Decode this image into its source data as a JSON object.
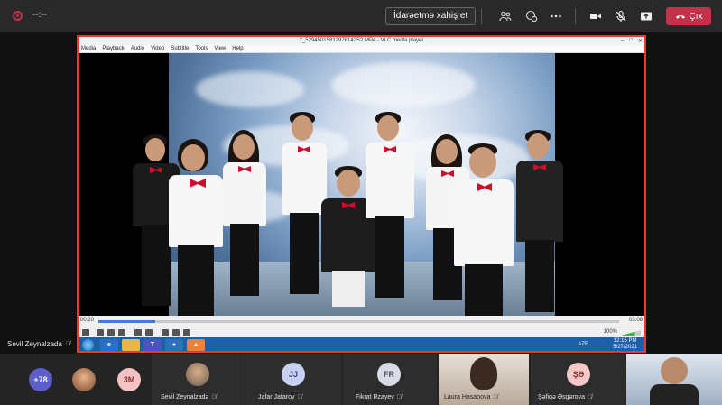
{
  "meeting": {
    "timer": "--:--",
    "request_control_label": "İdarəetmə xahiş et",
    "leave_label": "Çıx",
    "colors": {
      "leave": "#c4314b",
      "share_border": "#e23d2f",
      "recording": "#c4314b"
    },
    "icons": [
      "people-icon",
      "chat-icon",
      "more-icon",
      "camera-icon",
      "mic-off-icon",
      "share-icon",
      "phone-icon"
    ]
  },
  "vlc": {
    "title": "2_52945015812978142S2.MP4 - VLC media player",
    "menu": [
      "Media",
      "Playback",
      "Audio",
      "Video",
      "Subtitle",
      "Tools",
      "View",
      "Help"
    ],
    "time_elapsed": "00:20",
    "time_total": "03:08",
    "progress": 0.11,
    "volume_label": "100%"
  },
  "taskbar": {
    "tray_text": "AZE",
    "clock_time": "12:15 PM",
    "clock_date": "5/27/2021"
  },
  "presenter": {
    "name": "Sevil Zeynalzada"
  },
  "participants": [
    {
      "type": "count",
      "label": "+78",
      "color": "#5b5fc7"
    },
    {
      "type": "photo",
      "label": ""
    },
    {
      "type": "initials",
      "label": "3M",
      "color": "#f4c3c3"
    },
    {
      "type": "photo",
      "label": "",
      "name": "Sevil Zeynalzadə"
    },
    {
      "type": "initials",
      "label": "JJ",
      "color": "#c8d1f2",
      "name": "Jafar Jafarov"
    },
    {
      "type": "initials",
      "label": "FR",
      "color": "#d9dce5",
      "name": "Fikrat Rzayev"
    },
    {
      "type": "video",
      "label": "",
      "name": "Laura Hasanova"
    },
    {
      "type": "initials",
      "label": "ŞƏ",
      "color": "#f6c9c9",
      "name": "Şəfiqə Əsgərova"
    },
    {
      "type": "video",
      "label": ""
    }
  ]
}
